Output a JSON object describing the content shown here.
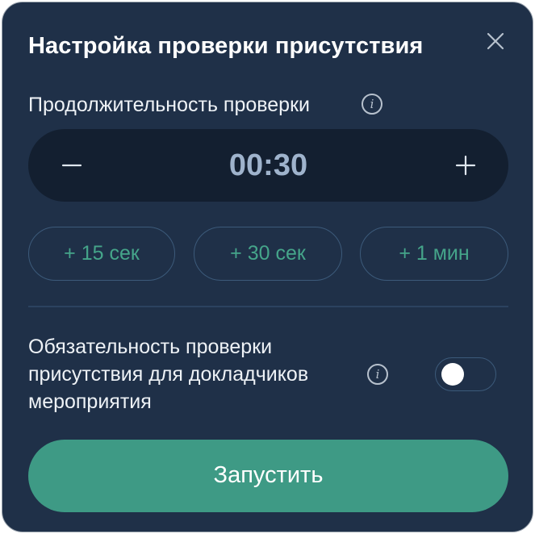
{
  "dialog": {
    "title": "Настройка проверки присутствия",
    "close_icon": "close-icon"
  },
  "duration": {
    "label": "Продолжительность проверки",
    "info_icon": "info-icon",
    "info_glyph": "i",
    "value": "00:30",
    "decrement_icon": "minus-icon",
    "increment_icon": "plus-icon"
  },
  "presets": [
    {
      "label": "+ 15 сек"
    },
    {
      "label": "+ 30 сек"
    },
    {
      "label": "+ 1 мин"
    }
  ],
  "required": {
    "label": "Обязательность проверки присутствия для докладчиков мероприятия",
    "info_glyph": "i",
    "toggle_on": false
  },
  "actions": {
    "start_label": "Запустить"
  },
  "colors": {
    "dialog_bg": "#1f3048",
    "stepper_bg": "#131f30",
    "accent": "#3e9a85",
    "preset_text": "#45a58a",
    "value_text": "#9fb3cc"
  }
}
